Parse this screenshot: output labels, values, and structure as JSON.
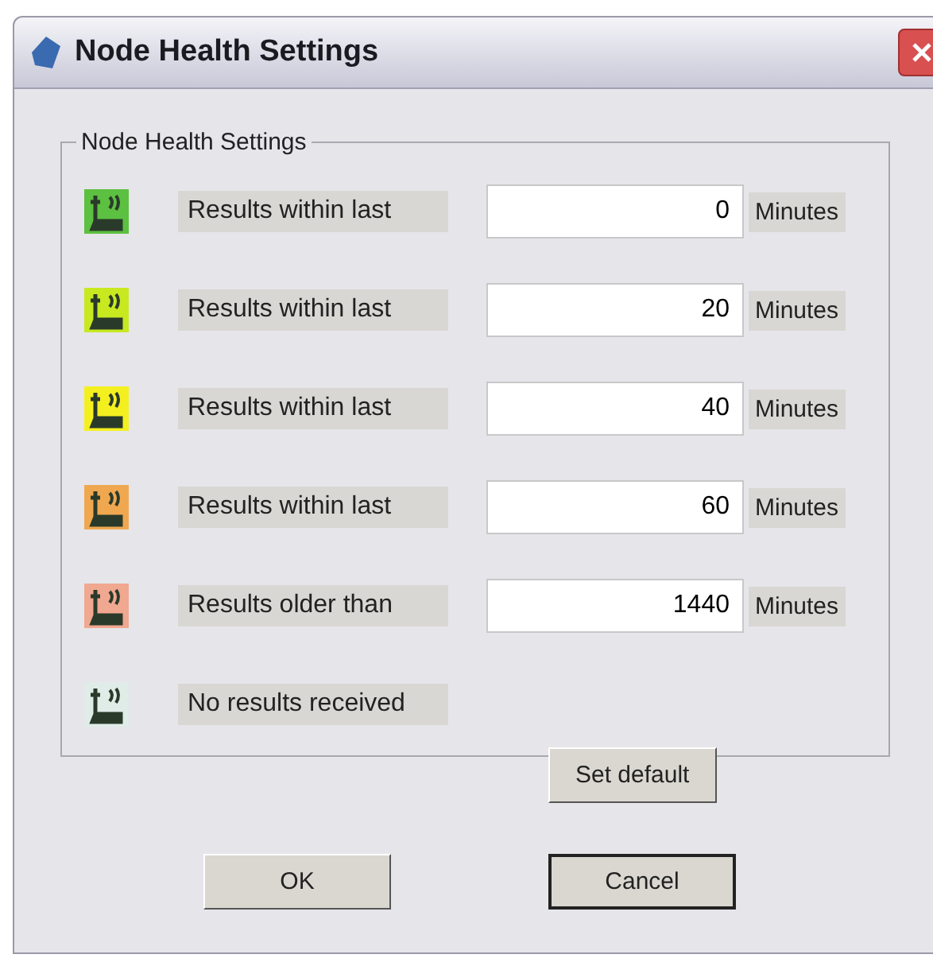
{
  "window": {
    "title": "Node Health Settings"
  },
  "group": {
    "title": "Node Health Settings",
    "rows": [
      {
        "kind": "input",
        "color": "#5cc040",
        "label": "Results within last",
        "value": "0",
        "unit": "Minutes"
      },
      {
        "kind": "input",
        "color": "#c8e820",
        "label": "Results within last",
        "value": "20",
        "unit": "Minutes"
      },
      {
        "kind": "input",
        "color": "#f4f020",
        "label": "Results within last",
        "value": "40",
        "unit": "Minutes"
      },
      {
        "kind": "input",
        "color": "#f0a850",
        "label": "Results within last",
        "value": "60",
        "unit": "Minutes"
      },
      {
        "kind": "input",
        "color": "#f0a890",
        "label": "Results older than",
        "value": "1440",
        "unit": "Minutes"
      },
      {
        "kind": "plain",
        "color": "#e0ece8",
        "label": "No results received"
      }
    ],
    "button": "Set default"
  },
  "buttons": [
    {
      "label": "OK",
      "default": false
    },
    {
      "label": "Cancel",
      "default": true
    }
  ]
}
